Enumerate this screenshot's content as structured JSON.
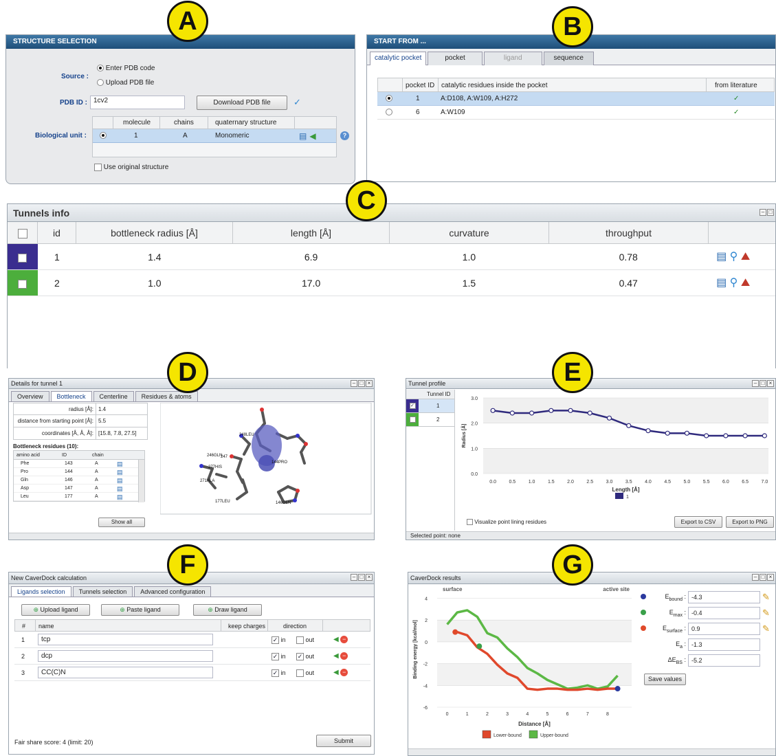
{
  "panel_labels": [
    "A",
    "B",
    "C",
    "D",
    "E",
    "F",
    "G"
  ],
  "structure": {
    "title": "STRUCTURE SELECTION",
    "source_label": "Source :",
    "src_opt1": "Enter PDB code",
    "src_opt2": "Upload PDB file",
    "pdb_label": "PDB ID :",
    "pdb_value": "1cv2",
    "download": "Download PDB file",
    "bio_label": "Biological unit :",
    "headers": [
      "molecule",
      "chains",
      "quaternary structure"
    ],
    "row": [
      "1",
      "A",
      "Monomeric"
    ],
    "use_original": "Use original structure"
  },
  "start": {
    "title": "START FROM ...",
    "tabs": [
      "catalytic pocket",
      "pocket",
      "ligand",
      "sequence"
    ],
    "headers": [
      "pocket ID",
      "catalytic residues inside the pocket",
      "from literature"
    ],
    "rows": [
      {
        "id": "1",
        "res": "A:D108, A:W109, A:H272",
        "lit": "✓"
      },
      {
        "id": "6",
        "res": "A:W109",
        "lit": "✓"
      }
    ]
  },
  "tunnels": {
    "title": "Tunnels info",
    "headers": [
      "id",
      "bottleneck radius [Å]",
      "length [Å]",
      "curvature",
      "throughput"
    ],
    "rows": [
      {
        "id": "1",
        "radius": "1.4",
        "length": "6.9",
        "curv": "1.0",
        "through": "0.78",
        "color": "#3a2d8f"
      },
      {
        "id": "2",
        "radius": "1.0",
        "length": "17.0",
        "curv": "1.5",
        "through": "0.47",
        "color": "#4cae3c"
      }
    ]
  },
  "details": {
    "title": "Details for tunnel 1",
    "tabs": [
      "Overview",
      "Bottleneck",
      "Centerline",
      "Residues & atoms"
    ],
    "props": [
      {
        "k": "radius [Å]:",
        "v": "1.4"
      },
      {
        "k": "distance from starting point [Å]:",
        "v": "5.5"
      },
      {
        "k": "coordinates [Å, Å, Å]:",
        "v": "[15.8, 7.8, 27.5]"
      }
    ],
    "res_title": "Bottleneck residues (10):",
    "res_headers": [
      "amino acid",
      "ID",
      "chain"
    ],
    "residues": [
      [
        "Phe",
        "143",
        "A"
      ],
      [
        "Pro",
        "144",
        "A"
      ],
      [
        "Gln",
        "146",
        "A"
      ],
      [
        "Asp",
        "147",
        "A"
      ],
      [
        "Leu",
        "177",
        "A"
      ]
    ],
    "show_all": "Show all",
    "mol_labels": [
      "248LEU",
      "246GLN",
      "247",
      "277HIS",
      "144PRO",
      "271ALA",
      "177LEU",
      "146GLN"
    ]
  },
  "profile": {
    "title": "Tunnel profile",
    "col": "Tunnel ID",
    "ids": [
      "1",
      "2"
    ],
    "xlabel": "Length [Å]",
    "ylabel": "Radius [Å]",
    "legend": "1",
    "visualize": "Visualize point lining residues",
    "csv": "Export to CSV",
    "png": "Export to PNG",
    "status": "Selected point: none"
  },
  "newcalc": {
    "title": "New CaverDock calculation",
    "tabs": [
      "Ligands selection",
      "Tunnels selection",
      "Advanced configuration"
    ],
    "upload": "Upload ligand",
    "paste": "Paste ligand",
    "draw": "Draw ligand",
    "headers": [
      "#",
      "name",
      "keep charges",
      "direction"
    ],
    "rows": [
      {
        "n": "1",
        "name": "tcp",
        "in": "in",
        "out": "out",
        "inchk": "✓",
        "outchk": ""
      },
      {
        "n": "2",
        "name": "dcp",
        "in": "in",
        "out": "out",
        "inchk": "✓",
        "outchk": "✓"
      },
      {
        "n": "3",
        "name": "CC(C)N",
        "in": "in",
        "out": "out",
        "inchk": "✓",
        "outchk": ""
      }
    ],
    "fair": "Fair share score: 4 (limit: 20)",
    "submit": "Submit"
  },
  "results": {
    "title": "CaverDock results",
    "surface": "surface",
    "active": "active site",
    "xlabel": "Distance [Å]",
    "ylabel": "Binding energy [kcal/mol]",
    "legend_lower": "Lower-bound",
    "legend_upper": "Upper-bound",
    "energies": [
      {
        "sym": "E",
        "sub": "bound",
        "val": "-4.3",
        "color": "#2b3a9e",
        "pencil": true
      },
      {
        "sym": "E",
        "sub": "max",
        "val": "-0.4",
        "color": "#3aa04a",
        "pencil": true
      },
      {
        "sym": "E",
        "sub": "surface",
        "val": "0.9",
        "color": "#e04a2a",
        "pencil": true
      },
      {
        "sym": "E",
        "sub": "a",
        "val": "-1.3",
        "color": "",
        "pencil": false
      },
      {
        "sym": "ΔE",
        "sub": "BS",
        "val": "-5.2",
        "color": "",
        "pencil": false
      }
    ],
    "save": "Save values"
  },
  "chart_data": [
    {
      "type": "line",
      "title": "",
      "xlabel": "Length [Å]",
      "ylabel": "Radius [Å]",
      "x": [
        0.0,
        0.5,
        1.0,
        1.5,
        2.0,
        2.5,
        3.0,
        3.5,
        4.0,
        4.5,
        5.0,
        5.5,
        6.0,
        6.5,
        7.0
      ],
      "xlim": [
        -0.25,
        7.1
      ],
      "ylim": [
        0,
        3.0
      ],
      "yticks": [
        "0.0",
        "1.0",
        "2.0",
        "3.0"
      ],
      "series": [
        {
          "name": "1",
          "values": [
            2.5,
            2.4,
            2.4,
            2.5,
            2.5,
            2.4,
            2.2,
            1.9,
            1.7,
            1.6,
            1.6,
            1.5,
            1.5,
            1.5,
            1.5
          ],
          "color": "#2f2a7d"
        }
      ]
    },
    {
      "type": "line",
      "title": "",
      "xlabel": "Distance [Å]",
      "ylabel": "Binding energy [kcal/mol]",
      "xlim": [
        -0.5,
        9.2
      ],
      "ylim": [
        -6,
        4.6
      ],
      "xticks": [
        0,
        1,
        2,
        3,
        4,
        5,
        6,
        7,
        8
      ],
      "yticks": [
        4,
        2,
        0,
        -2,
        -4,
        -6
      ],
      "series": [
        {
          "name": "Upper-bound",
          "color": "#5cb845",
          "x": [
            0,
            0.5,
            1,
            1.5,
            2,
            2.5,
            3,
            3.5,
            4,
            4.5,
            5,
            5.5,
            6,
            6.5,
            7,
            7.5,
            8,
            8.5
          ],
          "values": [
            1.6,
            2.7,
            2.9,
            2.3,
            0.8,
            0.4,
            -0.6,
            -1.4,
            -2.4,
            -2.9,
            -3.5,
            -3.9,
            -4.3,
            -4.2,
            -4.0,
            -4.3,
            -4.1,
            -3.1
          ]
        },
        {
          "name": "Lower-bound",
          "color": "#e0482c",
          "x": [
            0.5,
            1,
            1.5,
            2,
            2.5,
            3,
            3.5,
            4,
            4.5,
            5,
            5.5,
            6,
            6.5,
            7,
            7.5,
            8,
            8.5
          ],
          "values": [
            0.9,
            0.6,
            -0.5,
            -1.1,
            -2.1,
            -2.9,
            -3.3,
            -4.3,
            -4.4,
            -4.3,
            -4.3,
            -4.4,
            -4.4,
            -4.3,
            -4.4,
            -4.3,
            -4.3
          ]
        }
      ],
      "points": [
        {
          "label": "E_surface",
          "x": 0.4,
          "y": 0.9,
          "color": "#e04a2a"
        },
        {
          "label": "E_max",
          "x": 1.6,
          "y": -0.4,
          "color": "#3aa04a"
        },
        {
          "label": "E_bound",
          "x": 8.5,
          "y": -4.3,
          "color": "#2b3a9e"
        }
      ]
    }
  ]
}
